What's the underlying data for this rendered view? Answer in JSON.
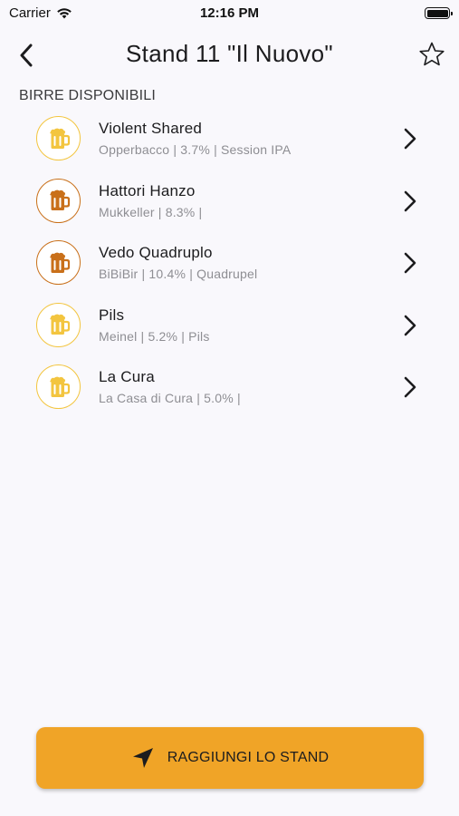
{
  "status_bar": {
    "carrier": "Carrier",
    "time": "12:16 PM",
    "battery_level": 1.0
  },
  "nav": {
    "title": "Stand 11 \"Il Nuovo\"",
    "back_icon": "chevron-left-icon",
    "favorite_icon": "star-outline-icon"
  },
  "section": {
    "header": "BIRRE DISPONIBILI"
  },
  "beers": [
    {
      "name": "Violent Shared",
      "subtitle": "Opperbacco | 3.7% | Session IPA",
      "icon": "beer-mug-icon",
      "tone": "light",
      "color": "#f3c53f"
    },
    {
      "name": "Hattori Hanzo",
      "subtitle": "Mukkeller | 8.3% |",
      "icon": "beer-mug-icon",
      "tone": "dark",
      "color": "#c9701a"
    },
    {
      "name": "Vedo Quadruplo",
      "subtitle": "BiBiBir | 10.4% | Quadrupel",
      "icon": "beer-mug-icon",
      "tone": "dark",
      "color": "#c9701a"
    },
    {
      "name": "Pils",
      "subtitle": "Meinel | 5.2% | Pils",
      "icon": "beer-mug-icon",
      "tone": "light",
      "color": "#f3c53f"
    },
    {
      "name": "La Cura",
      "subtitle": "La Casa di Cura | 5.0% |",
      "icon": "beer-mug-icon",
      "tone": "light",
      "color": "#f3c53f"
    }
  ],
  "cta": {
    "label": "RAGGIUNGI LO STAND",
    "icon": "navigation-arrow-icon",
    "color": "#f0a427"
  }
}
